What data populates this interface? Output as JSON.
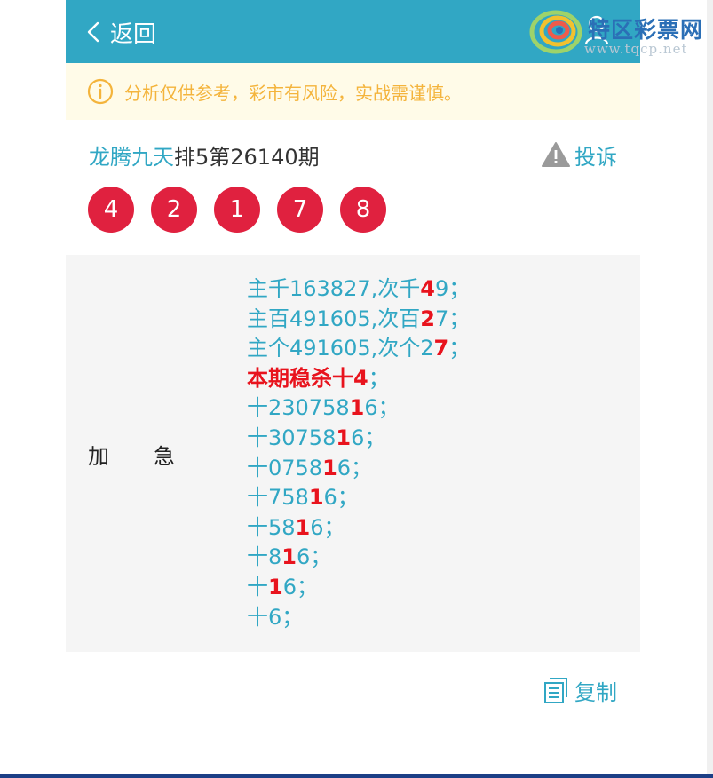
{
  "header": {
    "back_label": "返回"
  },
  "watermark": {
    "name": "特区彩票网",
    "url": "www.tqcp.net"
  },
  "notice": {
    "text": "分析仅供参考，彩市有风险，实战需谨慎。"
  },
  "post": {
    "author": "龙腾九天",
    "issue": "排5第26140期",
    "report_label": "投诉",
    "numbers": [
      "4",
      "2",
      "1",
      "7",
      "8"
    ]
  },
  "panel": {
    "label": "加急",
    "lines": [
      {
        "segments": [
          {
            "t": "主千163827,次千",
            "h": false
          },
          {
            "t": "4",
            "h": true
          },
          {
            "t": "9；",
            "h": false
          }
        ]
      },
      {
        "segments": [
          {
            "t": "主百491605,次百",
            "h": false
          },
          {
            "t": "2",
            "h": true
          },
          {
            "t": "7；",
            "h": false
          }
        ]
      },
      {
        "segments": [
          {
            "t": "主个491605,次个2",
            "h": false
          },
          {
            "t": "7",
            "h": true
          },
          {
            "t": "；",
            "h": false
          }
        ]
      },
      {
        "segments": [
          {
            "t": "本期稳杀十4",
            "h": true
          },
          {
            "t": "；",
            "h": false
          }
        ]
      },
      {
        "segments": [
          {
            "t": "十230758",
            "h": false
          },
          {
            "t": "1",
            "h": true
          },
          {
            "t": "6；",
            "h": false
          }
        ]
      },
      {
        "segments": [
          {
            "t": "十30758",
            "h": false
          },
          {
            "t": "1",
            "h": true
          },
          {
            "t": "6；",
            "h": false
          }
        ]
      },
      {
        "segments": [
          {
            "t": "十0758",
            "h": false
          },
          {
            "t": "1",
            "h": true
          },
          {
            "t": "6；",
            "h": false
          }
        ]
      },
      {
        "segments": [
          {
            "t": "十758",
            "h": false
          },
          {
            "t": "1",
            "h": true
          },
          {
            "t": "6；",
            "h": false
          }
        ]
      },
      {
        "segments": [
          {
            "t": "十58",
            "h": false
          },
          {
            "t": "1",
            "h": true
          },
          {
            "t": "6；",
            "h": false
          }
        ]
      },
      {
        "segments": [
          {
            "t": "十8",
            "h": false
          },
          {
            "t": "1",
            "h": true
          },
          {
            "t": "6；",
            "h": false
          }
        ]
      },
      {
        "segments": [
          {
            "t": "十",
            "h": false
          },
          {
            "t": "1",
            "h": true
          },
          {
            "t": "6；",
            "h": false
          }
        ]
      },
      {
        "segments": [
          {
            "t": "十6；",
            "h": false
          }
        ]
      }
    ]
  },
  "actions": {
    "copy_label": "复制"
  },
  "colors": {
    "header": "#31a7c4",
    "accent": "#31a7c4",
    "ball": "#e0213f",
    "highlight": "#e8131d",
    "notice_bg": "#fffbe8",
    "notice_text": "#f4b43c",
    "panel_bg": "#f5f5f5"
  },
  "icons": {
    "back": "chevron-left-icon",
    "user": "user-icon",
    "notice": "info-circle-icon",
    "report": "warning-triangle-icon",
    "copy": "copy-document-icon"
  }
}
